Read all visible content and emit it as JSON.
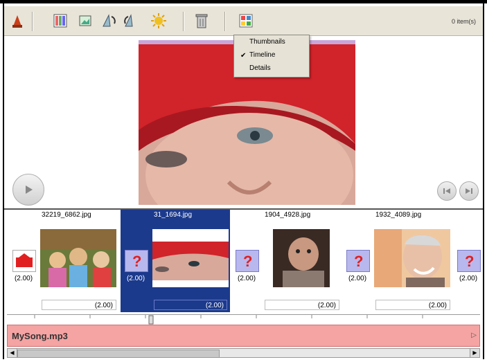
{
  "toolbar": {
    "items_count": "0 item(s)",
    "icons": [
      "import-icon",
      "color-grid-icon",
      "image-icon",
      "rotate-left-icon",
      "rotate-right-icon",
      "effects-sun-icon",
      "delete-trash-icon",
      "view-mode-icon"
    ]
  },
  "view_menu": {
    "items": [
      "Thumbnails",
      "Timeline",
      "Details"
    ],
    "checked": "Timeline"
  },
  "timeline": {
    "slides": [
      {
        "name": "32219_6862.jpg",
        "duration": "(2.00)"
      },
      {
        "name": "31_1694.jpg",
        "duration": "(2.00)"
      },
      {
        "name": "1904_4928.jpg",
        "duration": "(2.00)"
      },
      {
        "name": "1932_4089.jpg",
        "duration": "(2.00)"
      }
    ],
    "transitions": [
      {
        "duration": "(2.00)"
      },
      {
        "duration": "(2.00)"
      },
      {
        "duration": "(2.00)"
      },
      {
        "duration": "(2.00)"
      },
      {
        "duration": "(2.00)"
      }
    ]
  },
  "audio": {
    "track_name": "MySong.mp3"
  },
  "colors": {
    "selection": "#1c3a8c",
    "audio_track": "#f5a3a3",
    "transition_tile": "#b8b8ee"
  }
}
